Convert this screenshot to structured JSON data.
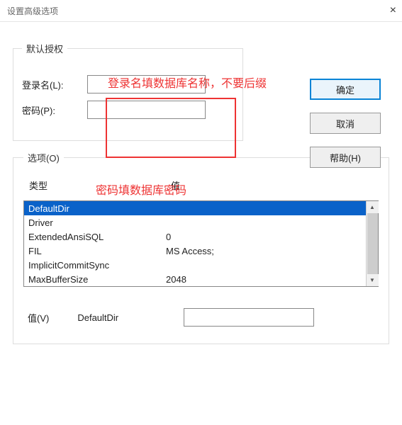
{
  "window": {
    "title": "设置高级选项",
    "close": "×"
  },
  "auth": {
    "legend": "默认授权",
    "login_label": "登录名(L):",
    "login_value": "",
    "password_label": "密码(P):",
    "password_value": ""
  },
  "annotations": {
    "top": "登录名填数据库名称，不要后缀",
    "bottom": "密码填数据库密码"
  },
  "buttons": {
    "ok": "确定",
    "cancel": "取消",
    "help": "帮助(H)"
  },
  "options": {
    "legend": "选项(O)",
    "header_type": "类型",
    "header_value": "值",
    "rows": [
      {
        "type": "DefaultDir",
        "value": "",
        "selected": true
      },
      {
        "type": "Driver",
        "value": ""
      },
      {
        "type": "ExtendedAnsiSQL",
        "value": "0"
      },
      {
        "type": "FIL",
        "value": "MS Access;"
      },
      {
        "type": "ImplicitCommitSync",
        "value": ""
      },
      {
        "type": "MaxBufferSize",
        "value": "2048"
      }
    ],
    "value_label": "值(V)",
    "value_name": "DefaultDir",
    "value_input": ""
  },
  "scroll": {
    "up": "▲",
    "down": "▼"
  }
}
